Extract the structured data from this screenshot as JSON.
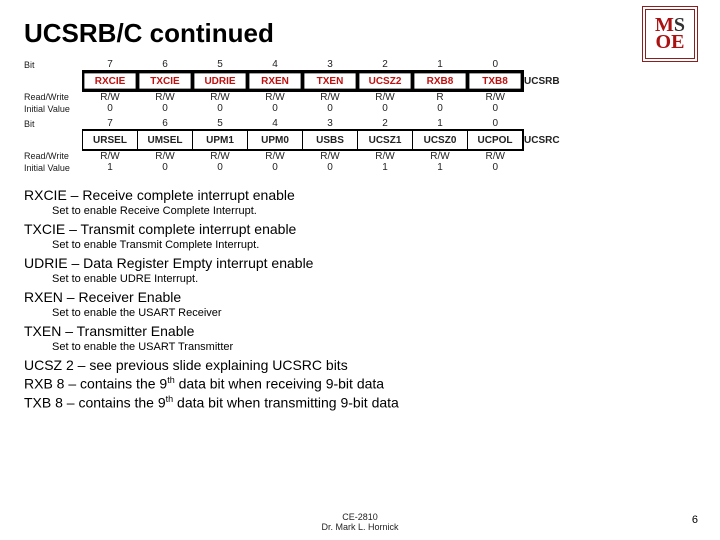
{
  "title": "UCSRB/C continued",
  "labels": {
    "bit": "Bit",
    "rw": "Read/Write",
    "iv": "Initial Value"
  },
  "bits": [
    "7",
    "6",
    "5",
    "4",
    "3",
    "2",
    "1",
    "0"
  ],
  "regB": {
    "name": "UCSRB",
    "fields": [
      "RXCIE",
      "TXCIE",
      "UDRIE",
      "RXEN",
      "TXEN",
      "UCSZ2",
      "RXB8",
      "TXB8"
    ],
    "rw": [
      "R/W",
      "R/W",
      "R/W",
      "R/W",
      "R/W",
      "R/W",
      "R",
      "R/W"
    ],
    "iv": [
      "0",
      "0",
      "0",
      "0",
      "0",
      "0",
      "0",
      "0"
    ]
  },
  "regC": {
    "name": "UCSRC",
    "fields": [
      "URSEL",
      "UMSEL",
      "UPM1",
      "UPM0",
      "USBS",
      "UCSZ1",
      "UCSZ0",
      "UCPOL"
    ],
    "rw": [
      "R/W",
      "R/W",
      "R/W",
      "R/W",
      "R/W",
      "R/W",
      "R/W",
      "R/W"
    ],
    "iv": [
      "1",
      "0",
      "0",
      "0",
      "0",
      "1",
      "1",
      "0"
    ]
  },
  "desc": [
    {
      "t": "RXCIE – Receive complete interrupt enable",
      "s": "Set to enable Receive Complete Interrupt."
    },
    {
      "t": "TXCIE – Transmit complete interrupt enable",
      "s": "Set to enable Transmit Complete Interrupt."
    },
    {
      "t": "UDRIE – Data Register Empty interrupt enable",
      "s": "Set to enable UDRE Interrupt."
    },
    {
      "t": "RXEN – Receiver Enable",
      "s": "Set to enable the USART Receiver"
    },
    {
      "t": "TXEN – Transmitter Enable",
      "s": "Set to enable the USART Transmitter"
    },
    {
      "t": "UCSZ 2 – see previous slide explaining UCSRC bits",
      "s": ""
    },
    {
      "t": "RXB 8 – contains the 9th data bit when receiving 9-bit data",
      "s": ""
    },
    {
      "t": "TXB 8 – contains the 9th data bit when transmitting 9-bit data",
      "s": ""
    }
  ],
  "footer": {
    "course": "CE-2810",
    "author": "Dr. Mark L. Hornick",
    "page": "6"
  }
}
